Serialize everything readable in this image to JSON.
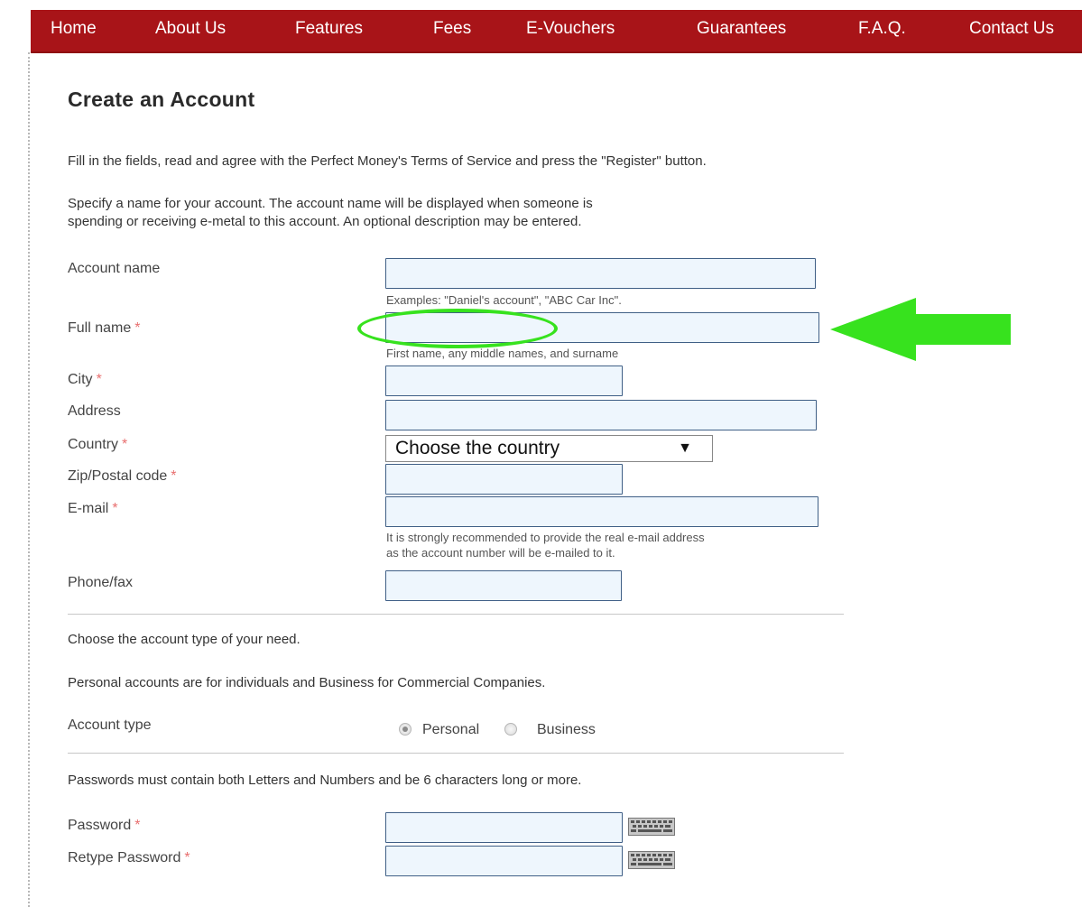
{
  "nav": {
    "items": [
      "Home",
      "About Us",
      "Features",
      "Fees",
      "E-Vouchers",
      "Guarantees",
      "F.A.Q.",
      "Contact Us"
    ]
  },
  "page": {
    "title": "Create an Account",
    "intro": "Fill in the fields, read and agree with the Perfect Money's Terms of Service and press the \"Register\" button.",
    "account_desc_line1": "Specify a name for your account. The account name will be displayed when someone is",
    "account_desc_line2": "spending or receiving e-metal to this account. An optional description may be entered."
  },
  "form": {
    "required_mark": "*",
    "account_name": {
      "label": "Account name",
      "value": "",
      "hint": "Examples: \"Daniel's account\", \"ABC Car Inc\"."
    },
    "full_name": {
      "label": "Full name",
      "value": "",
      "hint": "First name, any middle names, and surname"
    },
    "city": {
      "label": "City",
      "value": ""
    },
    "address": {
      "label": "Address",
      "value": ""
    },
    "country": {
      "label": "Country",
      "selected": "Choose the country",
      "arrow": "▼"
    },
    "zip": {
      "label": "Zip/Postal code",
      "value": ""
    },
    "email": {
      "label": "E-mail",
      "value": "",
      "hint_line1": "It is strongly recommended to provide the real e-mail address",
      "hint_line2": "as the account number will be e-mailed to it."
    },
    "phone": {
      "label": "Phone/fax",
      "value": ""
    },
    "account_type_intro": "Choose the account type of your need.",
    "account_type_desc": "Personal accounts are for individuals and Business for Commercial Companies.",
    "account_type": {
      "label": "Account type",
      "options": [
        "Personal",
        "Business"
      ],
      "selected": "Personal"
    },
    "password_rule": "Passwords must contain both Letters and Numbers and be 6 characters long or more.",
    "password": {
      "label": "Password",
      "value": ""
    },
    "retype_password": {
      "label": "Retype Password",
      "value": ""
    }
  },
  "colors": {
    "nav_background": "#a81418",
    "input_background": "#eef6fd",
    "input_border": "#3f5f86",
    "required_asterisk": "#e86f6f",
    "annotation_green": "#37e21e"
  },
  "icons": {
    "virtual_keyboard": "keyboard-icon",
    "annotation_arrow": "arrow-left-icon"
  }
}
